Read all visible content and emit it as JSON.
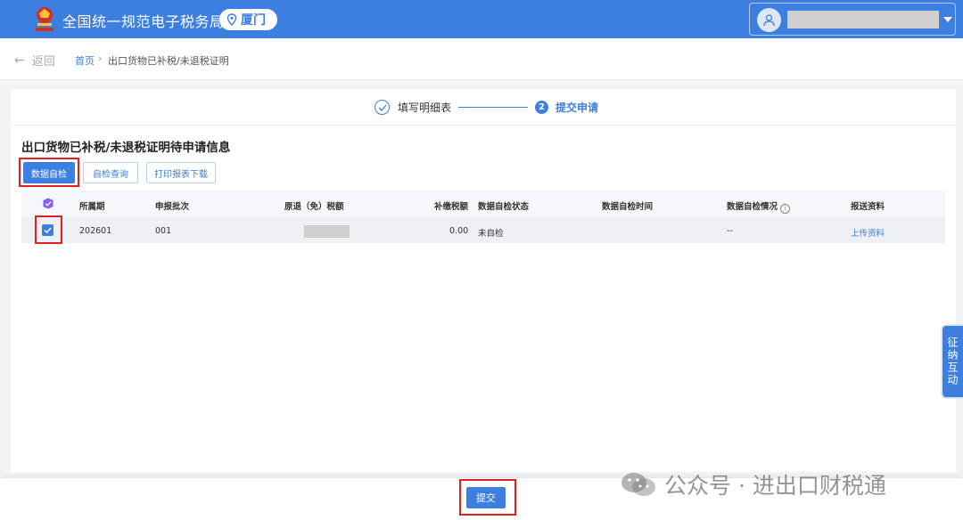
{
  "header": {
    "site_title": "全国统一规范电子税务局",
    "city": "厦门",
    "user_icon": "user-icon"
  },
  "breadcrumb": {
    "back_label": "返回",
    "home": "首页",
    "separator": "›",
    "current": "出口货物已补税/未退税证明"
  },
  "steps": [
    {
      "label": "填写明细表",
      "status": "done"
    },
    {
      "number": "2",
      "label": "提交申请",
      "status": "active"
    }
  ],
  "section_title": "出口货物已补税/未退税证明待申请信息",
  "toolbar": {
    "self_check": "数据自检",
    "check_query": "自检查询",
    "print_download": "打印报表下载"
  },
  "table": {
    "columns": [
      "所属期",
      "申报批次",
      "原退（免）税额",
      "补缴税额",
      "数据自检状态",
      "数据自检时间",
      "数据自检情况",
      "报送资料"
    ],
    "rows": [
      {
        "checked": true,
        "period": "202601",
        "batch": "001",
        "original_refund": "",
        "supplementary_tax": "0.00",
        "check_status": "未自检",
        "check_time": "",
        "check_situation": "--",
        "submit_docs": "上传资料"
      }
    ]
  },
  "side_float_label": "征纳互动",
  "footer": {
    "submit": "提交"
  },
  "watermark": {
    "text": "公众号 · 进出口财税通"
  },
  "colors": {
    "primary": "#3d7fe0",
    "highlight_box": "#e0201e"
  }
}
